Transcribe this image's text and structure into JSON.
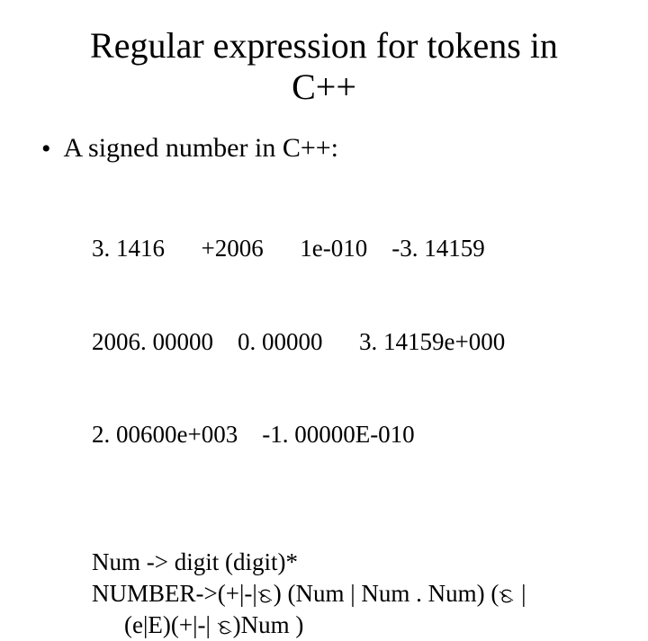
{
  "title_line1": "Regular expression for tokens in",
  "title_line2": "C++",
  "bullet": "A signed number in C++:",
  "examples": {
    "l1": "3. 1416      +2006      1e-010    -3. 14159",
    "l2": "2006. 00000    0. 00000      3. 14159e+000",
    "l3": "2. 00600e+003    -1. 00000E-010"
  },
  "grammar": {
    "g1": "Num -> digit (digit)*",
    "g2a": "NUMBER->(+|-|",
    "g2b": ") (Num |  Num . Num) (",
    "g2c": " |",
    "g3a": "(e|E)(+|-| ",
    "g3b": ")Num )"
  }
}
